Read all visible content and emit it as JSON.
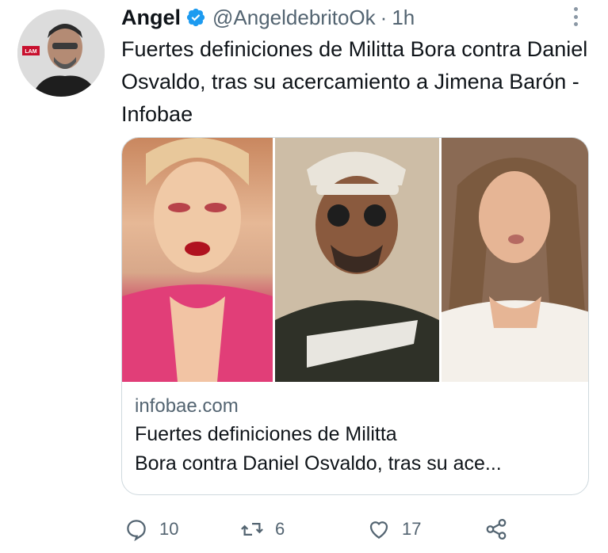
{
  "tweet": {
    "author_name": "Angel",
    "handle": "@AngeldebritoOk",
    "separator": "·",
    "time": "1h",
    "text": "Fuertes definiciones de Militta Bora contra Daniel Osvaldo, tras su acercamiento a Jimena Barón - Infobae"
  },
  "avatar": {
    "badge_text": "LAM"
  },
  "card": {
    "domain": "infobae.com",
    "title_line1": "Fuertes definiciones de Militta",
    "title_line2": "Bora contra Daniel Osvaldo, tras su ace..."
  },
  "actions": {
    "replies": "10",
    "retweets": "6",
    "likes": "17"
  },
  "icons": [
    "verified-badge-icon",
    "more-options-icon",
    "reply-icon",
    "retweet-icon",
    "like-icon",
    "share-icon"
  ],
  "colors": {
    "verified": "#1d9bf0",
    "secondary_text": "#536471",
    "border": "#cfd9de"
  }
}
